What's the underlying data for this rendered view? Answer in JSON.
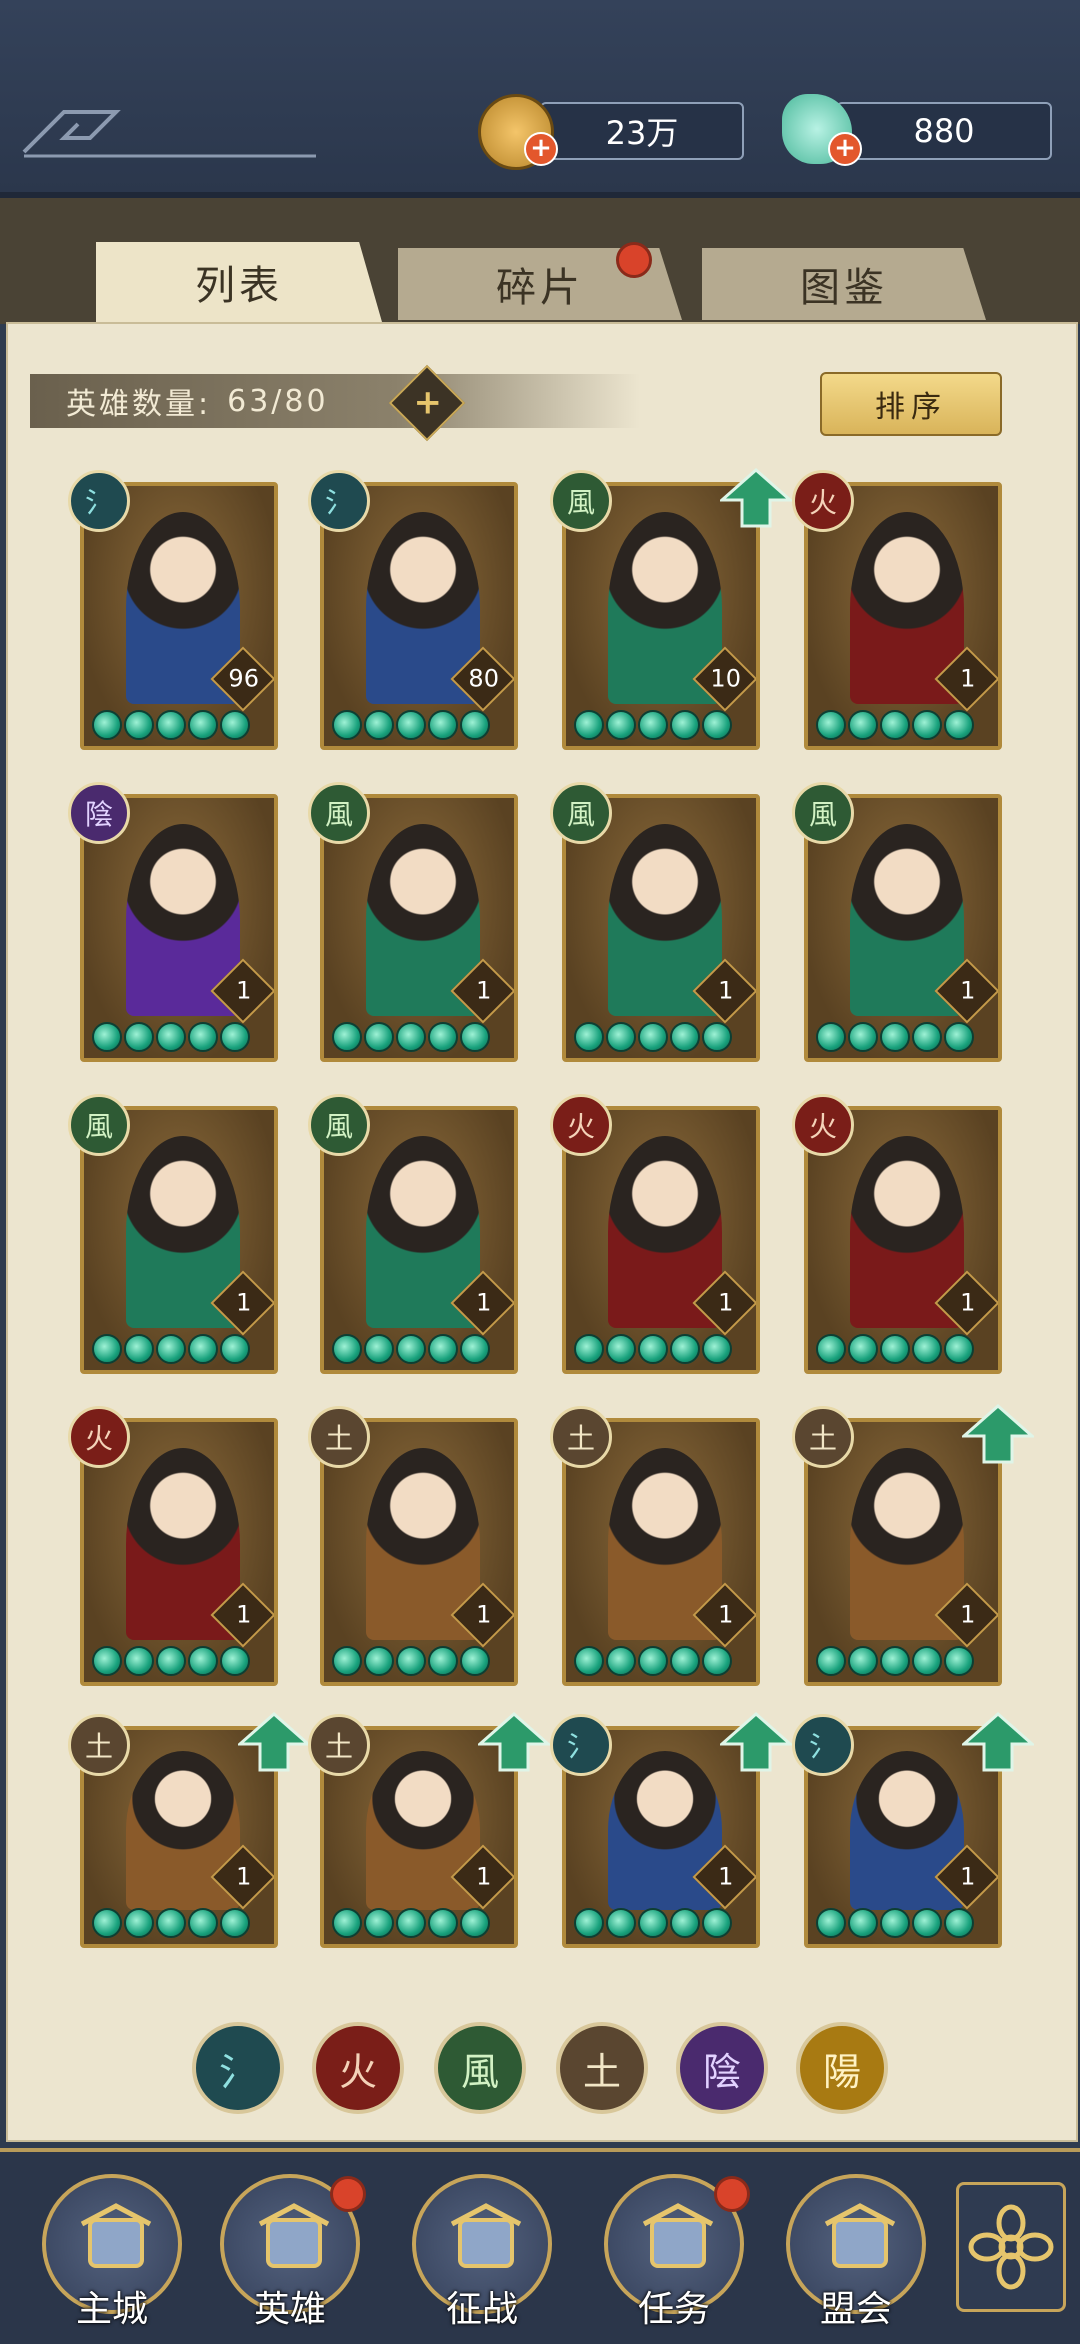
{
  "resources": {
    "coins": "23万",
    "jade": "880"
  },
  "tabs": [
    {
      "label": "列表",
      "active": true,
      "badge": false
    },
    {
      "label": "碎片",
      "active": false,
      "badge": true
    },
    {
      "label": "图鉴",
      "active": false,
      "badge": false
    }
  ],
  "hero_count": {
    "label": "英雄数量:",
    "value": "63/80"
  },
  "sort_label": "排序",
  "elements": {
    "water": "氵",
    "fire": "火",
    "wind": "風",
    "earth": "土",
    "yin": "陰",
    "yang": "陽"
  },
  "heroes": [
    {
      "element": "water",
      "level": "96",
      "upgrade": false
    },
    {
      "element": "water",
      "level": "80",
      "upgrade": false
    },
    {
      "element": "wind",
      "level": "10",
      "upgrade": true
    },
    {
      "element": "fire",
      "level": "1",
      "upgrade": false
    },
    {
      "element": "yin",
      "level": "1",
      "upgrade": false
    },
    {
      "element": "wind",
      "level": "1",
      "upgrade": false
    },
    {
      "element": "wind",
      "level": "1",
      "upgrade": false
    },
    {
      "element": "wind",
      "level": "1",
      "upgrade": false
    },
    {
      "element": "wind",
      "level": "1",
      "upgrade": false
    },
    {
      "element": "wind",
      "level": "1",
      "upgrade": false
    },
    {
      "element": "fire",
      "level": "1",
      "upgrade": false
    },
    {
      "element": "fire",
      "level": "1",
      "upgrade": false
    },
    {
      "element": "fire",
      "level": "1",
      "upgrade": false
    },
    {
      "element": "earth",
      "level": "1",
      "upgrade": false
    },
    {
      "element": "earth",
      "level": "1",
      "upgrade": false
    },
    {
      "element": "earth",
      "level": "1",
      "upgrade": true
    },
    {
      "element": "earth",
      "level": "1",
      "upgrade": true
    },
    {
      "element": "earth",
      "level": "1",
      "upgrade": true
    },
    {
      "element": "water",
      "level": "1",
      "upgrade": true
    },
    {
      "element": "water",
      "level": "1",
      "upgrade": true
    }
  ],
  "nav": [
    {
      "label": "主城",
      "icon": "city-icon",
      "badge": false
    },
    {
      "label": "英雄",
      "icon": "hero-icon",
      "badge": true
    },
    {
      "label": "征战",
      "icon": "battle-icon",
      "badge": false
    },
    {
      "label": "任务",
      "icon": "task-icon",
      "badge": true
    },
    {
      "label": "盟会",
      "icon": "guild-icon",
      "badge": false
    }
  ],
  "colors": {
    "panel": "#ece5cf",
    "frame": "#b08a3c",
    "accent_red": "#d9432a",
    "pearl": "#19a27d"
  }
}
